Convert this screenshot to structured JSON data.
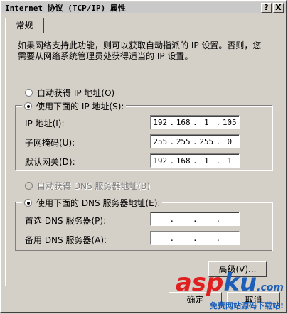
{
  "window": {
    "title": "Internet 协议 (TCP/IP) 属性",
    "help_btn": "?",
    "close_btn": "X"
  },
  "tabs": [
    {
      "label": "常规"
    }
  ],
  "description": "如果网络支持此功能，则可以获取自动指派的 IP 设置。否则，您需要从网络系统管理员处获得适当的 IP 设置。",
  "ip_mode": {
    "auto_label": "自动获得 IP 地址(O)",
    "manual_label": "使用下面的 IP 地址(S):",
    "selected": "manual"
  },
  "ip_fields": [
    {
      "label": "IP 地址(I):",
      "octets": [
        "192",
        "168",
        "1",
        "105"
      ]
    },
    {
      "label": "子网掩码(U):",
      "octets": [
        "255",
        "255",
        "255",
        "0"
      ]
    },
    {
      "label": "默认网关(D):",
      "octets": [
        "192",
        "168",
        "1",
        "1"
      ]
    }
  ],
  "dns_mode": {
    "auto_label": "自动获得 DNS 服务器地址(B)",
    "manual_label": "使用下面的 DNS 服务器地址(E):",
    "selected": "manual",
    "auto_disabled": true
  },
  "dns_fields": [
    {
      "label": "首选 DNS 服务器(P):",
      "octets": [
        "",
        "",
        "",
        ""
      ]
    },
    {
      "label": "备用 DNS 服务器(A):",
      "octets": [
        "",
        "",
        "",
        ""
      ]
    }
  ],
  "buttons": {
    "advanced": "高级(V)...",
    "ok": "确定",
    "cancel": "取消"
  },
  "watermark": {
    "asp": "asp",
    "ku": "ku",
    "suffix": ".com",
    "sub": "免费网站源码下载站!"
  }
}
